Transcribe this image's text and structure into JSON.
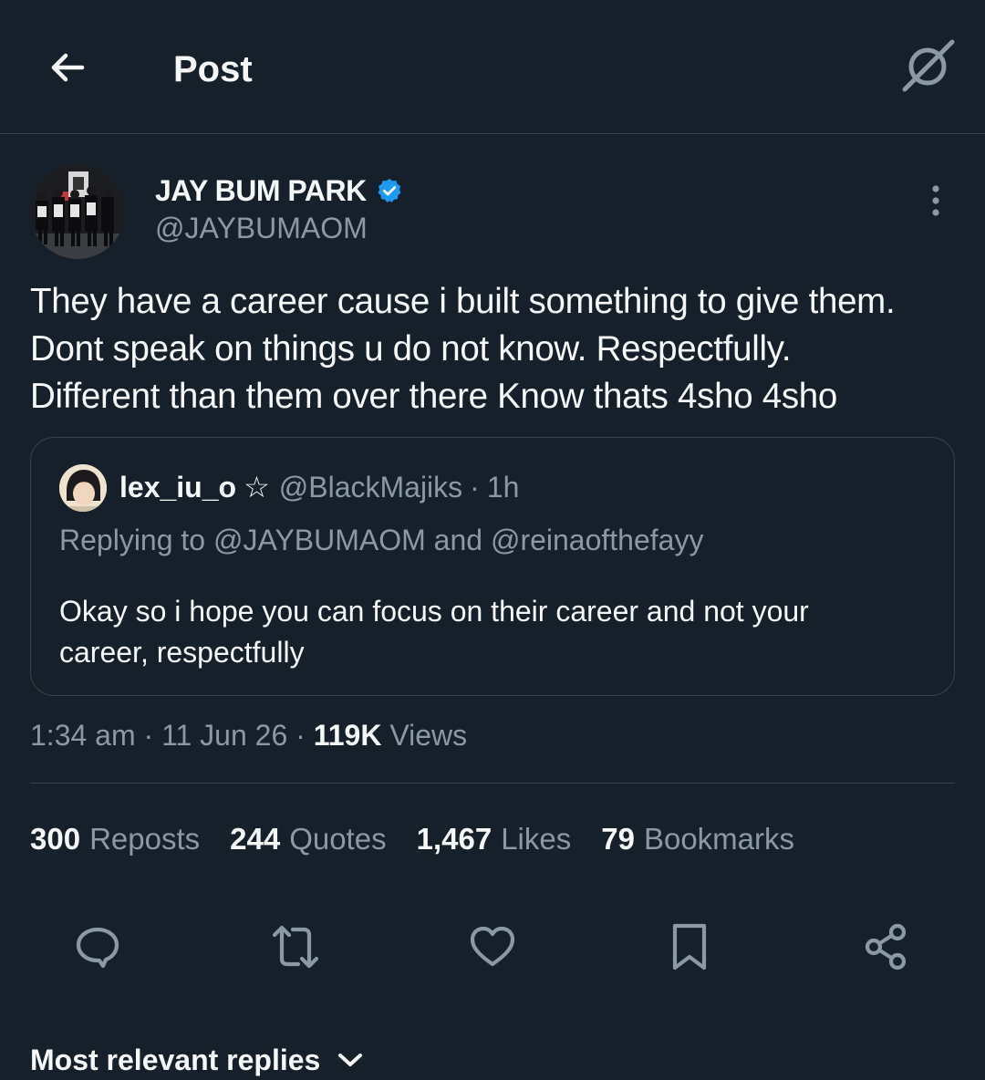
{
  "header": {
    "title": "Post",
    "back_icon": "arrow-left-icon",
    "grok_icon": "grok-icon"
  },
  "author": {
    "name": "JAY BUM PARK",
    "handle": "@JAYBUMAOM",
    "verified": true,
    "verified_color": "#1d9bf0"
  },
  "post": {
    "lines": [
      "They have a career cause i built something to give them.",
      "Dont speak on things u do not know.  Respectfully.",
      "Different than them over there Know thats 4sho 4sho"
    ]
  },
  "quote": {
    "name": "lex_iu_o",
    "name_symbol": "☆",
    "handle": "@BlackMajiks",
    "separator": "·",
    "time": "1h",
    "replying_to": "Replying to @JAYBUMAOM and @reinaofthefayy",
    "text": "Okay so i hope you can focus on their career and not your career, respectfully"
  },
  "meta": {
    "time": "1:34 am",
    "sep": "·",
    "date": "11 Jun 26",
    "views_count": "119K",
    "views_label": "Views"
  },
  "stats": [
    {
      "count": "300",
      "label": "Reposts"
    },
    {
      "count": "244",
      "label": "Quotes"
    },
    {
      "count": "1,467",
      "label": "Likes"
    },
    {
      "count": "79",
      "label": "Bookmarks"
    }
  ],
  "actions": [
    {
      "icon": "reply-icon"
    },
    {
      "icon": "repost-icon"
    },
    {
      "icon": "like-icon"
    },
    {
      "icon": "bookmark-icon"
    },
    {
      "icon": "share-icon"
    }
  ],
  "replies_sort": {
    "label": "Most relevant replies",
    "icon": "chevron-down-icon"
  },
  "colors": {
    "background": "#15202b",
    "text": "#f7f9f9",
    "secondary": "#8b98a5",
    "border": "#38444d",
    "accent": "#1d9bf0"
  }
}
